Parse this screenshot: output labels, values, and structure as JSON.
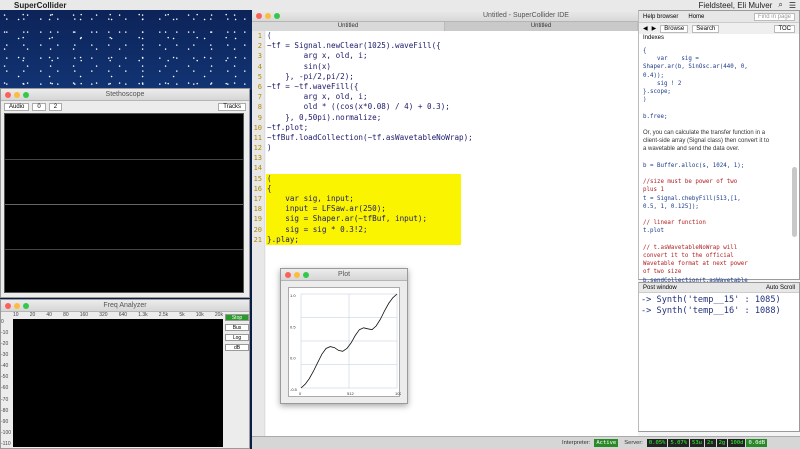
{
  "menubar": {
    "app_name": "SuperCollider",
    "user": "Fieldsteel, Eli Mulver"
  },
  "stethoscope": {
    "title": "Stethoscope",
    "rate": "Audio",
    "index": "0",
    "channels": "2",
    "style": "Tracks"
  },
  "freq_analyzer": {
    "title": "Freq Analyzer",
    "scale": [
      "10",
      "20",
      "40",
      "80",
      "160",
      "320",
      "640",
      "1.3k",
      "2.5k",
      "5k",
      "10k",
      "20k"
    ],
    "db_scale": [
      "0",
      "-10",
      "-20",
      "-30",
      "-40",
      "-50",
      "-60",
      "-70",
      "-80",
      "-90",
      "-100",
      "-110"
    ],
    "buttons": [
      "Stop",
      "Bus",
      "Log",
      "dB"
    ]
  },
  "ide": {
    "window_title": "Untitled - SuperCollider IDE",
    "tabs": [
      "Untitled",
      "Untitled"
    ],
    "line_numbers": [
      "1",
      "2",
      "3",
      "4",
      "5",
      "6",
      "7",
      "8",
      "9",
      "10",
      "11",
      "12",
      "13",
      "14",
      "15",
      "16",
      "17",
      "18",
      "19",
      "20",
      "21"
    ],
    "code": [
      "(",
      "~tf = Signal.newClear(1025).waveFill({",
      "        arg x, old, i;",
      "        sin(x)",
      "    }, -pi/2,pi/2);",
      "~tf = ~tf.waveFill({",
      "        arg x, old, i;",
      "        old * ((cos(x*0.08) / 4) + 0.3);",
      "    }, 0,50pi).normalize;",
      "~tf.plot;",
      "~tfBuf.loadCollection(~tf.asWavetableNoWrap);",
      ")",
      "",
      "",
      "(",
      "{",
      "    var sig, input;",
      "    input = LFSaw.ar(250);",
      "    sig = Shaper.ar(~tfBuf, input);",
      "    sig = sig * 0.3!2;",
      "}.play;"
    ]
  },
  "plot": {
    "title": "Plot",
    "y_labels": [
      "1.0",
      "0.5",
      "0.0",
      "-0.5"
    ],
    "x_labels": [
      "0",
      "512",
      "1024"
    ]
  },
  "help": {
    "title": "Help browser",
    "home": "Home",
    "search_placeholder": "Find in page",
    "nav": [
      "Browse",
      "Search",
      "TOC"
    ],
    "indexes": "Indexes",
    "body_lines": [
      {
        "t": "code",
        "v": "{"
      },
      {
        "t": "code",
        "v": "    var    sig ="
      },
      {
        "t": "code",
        "v": "Shaper.ar(b, SinOsc.ar(440, 0,"
      },
      {
        "t": "code",
        "v": "0.4));"
      },
      {
        "t": "code",
        "v": "    sig ! 2"
      },
      {
        "t": "code",
        "v": "}.scope;"
      },
      {
        "t": "code",
        "v": ")"
      },
      {
        "t": "code",
        "v": ""
      },
      {
        "t": "code",
        "v": "b.free;"
      },
      {
        "t": "code",
        "v": ""
      },
      {
        "t": "text",
        "v": "Or, you can calculate the transfer function in a"
      },
      {
        "t": "text",
        "v": "client-side array (Signal class) then convert it to"
      },
      {
        "t": "text",
        "v": "a wavetable and send the data over."
      },
      {
        "t": "code",
        "v": ""
      },
      {
        "t": "code",
        "v": "b = Buffer.alloc(s, 1024, 1);"
      },
      {
        "t": "code",
        "v": ""
      },
      {
        "t": "cmt",
        "v": "//size must be power of two"
      },
      {
        "t": "cmt",
        "v": "plus 1"
      },
      {
        "t": "code",
        "v": "t = Signal.chebyFill(513,[1,"
      },
      {
        "t": "code",
        "v": "0.5, 1, 0.125]);"
      },
      {
        "t": "code",
        "v": ""
      },
      {
        "t": "cmt",
        "v": "// linear function"
      },
      {
        "t": "code",
        "v": "t.plot"
      },
      {
        "t": "code",
        "v": ""
      },
      {
        "t": "cmt",
        "v": "// t.asWavetableNoWrap will"
      },
      {
        "t": "cmt",
        "v": "convert it to the official"
      },
      {
        "t": "cmt",
        "v": "Wavetable format at next power"
      },
      {
        "t": "cmt",
        "v": "of two size"
      },
      {
        "t": "code",
        "v": "b.sendCollection(t.asWavetable"
      },
      {
        "t": "code",
        "v": "NoWrap);  // may also use"
      }
    ]
  },
  "post": {
    "title": "Post window",
    "auto_scroll": "Auto Scroll",
    "lines": [
      "-> Synth('temp__15' : 1085)",
      "-> Synth('temp__16' : 1088)"
    ]
  },
  "status": {
    "interpreter_label": "Interpreter:",
    "interpreter_state": "Active",
    "server_label": "Server:",
    "values": [
      "0.05%",
      "5.07%",
      "53u",
      "2s",
      "2g",
      "100d",
      "0.0dB"
    ]
  },
  "plot_curve": [
    0.0,
    0.04,
    0.1,
    0.18,
    0.27,
    0.36,
    0.42,
    0.44,
    0.43,
    0.4,
    0.39,
    0.42,
    0.48,
    0.56,
    0.62,
    0.64,
    0.63,
    0.62,
    0.66,
    0.73,
    0.82,
    0.9,
    0.96,
    1.0
  ]
}
